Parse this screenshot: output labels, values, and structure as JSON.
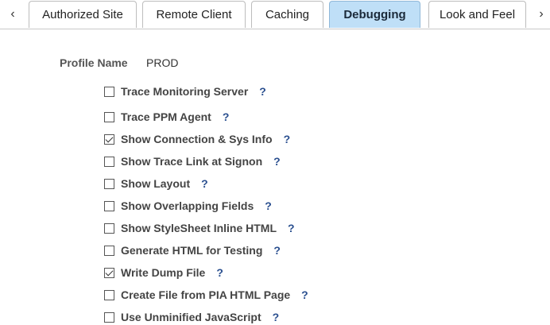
{
  "nav": {
    "prev_icon": "chevron-left-icon",
    "next_icon": "chevron-right-icon",
    "prev_glyph": "‹",
    "next_glyph": "›"
  },
  "tabs": [
    {
      "label": "Authorized Site",
      "active": false
    },
    {
      "label": "Remote Client",
      "active": false
    },
    {
      "label": "Caching",
      "active": false
    },
    {
      "label": "Debugging",
      "active": true
    },
    {
      "label": "Look and Feel",
      "active": false
    }
  ],
  "profile": {
    "label": "Profile Name",
    "value": "PROD"
  },
  "help_glyph": "?",
  "options": [
    {
      "label": "Trace Monitoring Server",
      "checked": false
    },
    {
      "label": "Trace PPM Agent",
      "checked": false
    },
    {
      "label": "Show Connection & Sys Info",
      "checked": true
    },
    {
      "label": "Show Trace Link at Signon",
      "checked": false
    },
    {
      "label": "Show Layout",
      "checked": false
    },
    {
      "label": "Show Overlapping Fields",
      "checked": false
    },
    {
      "label": "Show StyleSheet Inline HTML",
      "checked": false
    },
    {
      "label": "Generate HTML for Testing",
      "checked": false
    },
    {
      "label": "Write Dump File",
      "checked": true
    },
    {
      "label": "Create File from PIA HTML Page",
      "checked": false
    },
    {
      "label": "Use Unminified JavaScript",
      "checked": false
    }
  ],
  "colors": {
    "active_tab_bg": "#bfdff7",
    "help_icon": "#2a4f8f"
  }
}
